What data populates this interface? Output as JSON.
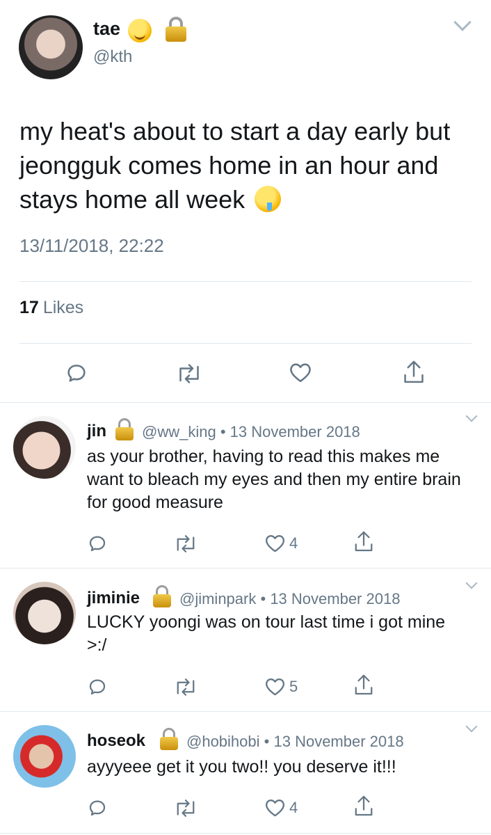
{
  "main": {
    "name": "tae",
    "handle": "@kth",
    "text": "my heat's about to start a day early but jeongguk comes home in an hour and stays home all week",
    "timestamp": "13/11/2018, 22:22",
    "likes_count": "17",
    "likes_label": "Likes"
  },
  "replies": [
    {
      "name": "jin",
      "handle": "@ww_king",
      "date": "13 November 2018",
      "text": "as your brother, having to read this makes me want to bleach my eyes and then my entire brain for good measure",
      "likes": "4"
    },
    {
      "name": "jiminie",
      "handle": "@jiminpark",
      "date": "13 November 2018",
      "text": "LUCKY yoongi was on tour last time i got mine >:/",
      "likes": "5"
    },
    {
      "name": "hoseok",
      "handle": "@hobihobi",
      "date": "13 November 2018",
      "text": "ayyyeee get it you two!! you deserve it!!!",
      "likes": "4"
    }
  ],
  "meta_separator": "•",
  "icons": {
    "reply": "reply-icon",
    "retweet": "retweet-icon",
    "like": "heart-icon",
    "share": "share-icon",
    "lock": "lock-icon",
    "more": "chevron-down-icon"
  },
  "colors": {
    "text": "#14171a",
    "secondary": "#657786",
    "divider": "#e1e8ed",
    "icon": "#657786"
  }
}
